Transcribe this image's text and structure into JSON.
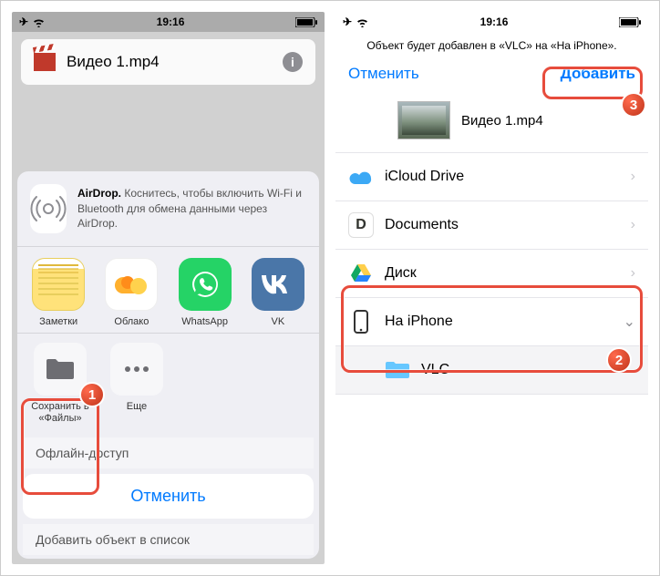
{
  "statusbar": {
    "time": "19:16"
  },
  "left": {
    "file_title": "Видео 1.mp4",
    "stub1": "Офлайн-доступ",
    "stub2": "Добавить объект в список",
    "sheet": {
      "airdrop_bold": "AirDrop.",
      "airdrop_text": " Коснитесь, чтобы включить Wi-Fi и Bluetooth для обмена данными через AirDrop.",
      "apps": [
        {
          "label": "Заметки"
        },
        {
          "label": "Облако"
        },
        {
          "label": "WhatsApp"
        },
        {
          "label": "VK"
        }
      ],
      "actions": [
        {
          "label": "Сохранить в «Файлы»"
        },
        {
          "label": "Еще"
        }
      ],
      "cancel": "Отменить"
    }
  },
  "right": {
    "hint": "Объект будет добавлен в «VLC» на «На iPhone».",
    "cancel": "Отменить",
    "add": "Добавить",
    "filename": "Видео 1.mp4",
    "locations": [
      {
        "label": "iCloud Drive"
      },
      {
        "label": "Documents"
      },
      {
        "label": "Диск"
      },
      {
        "label": "На iPhone"
      }
    ],
    "sub": "VLC"
  },
  "badges": {
    "b1": "1",
    "b2": "2",
    "b3": "3"
  }
}
